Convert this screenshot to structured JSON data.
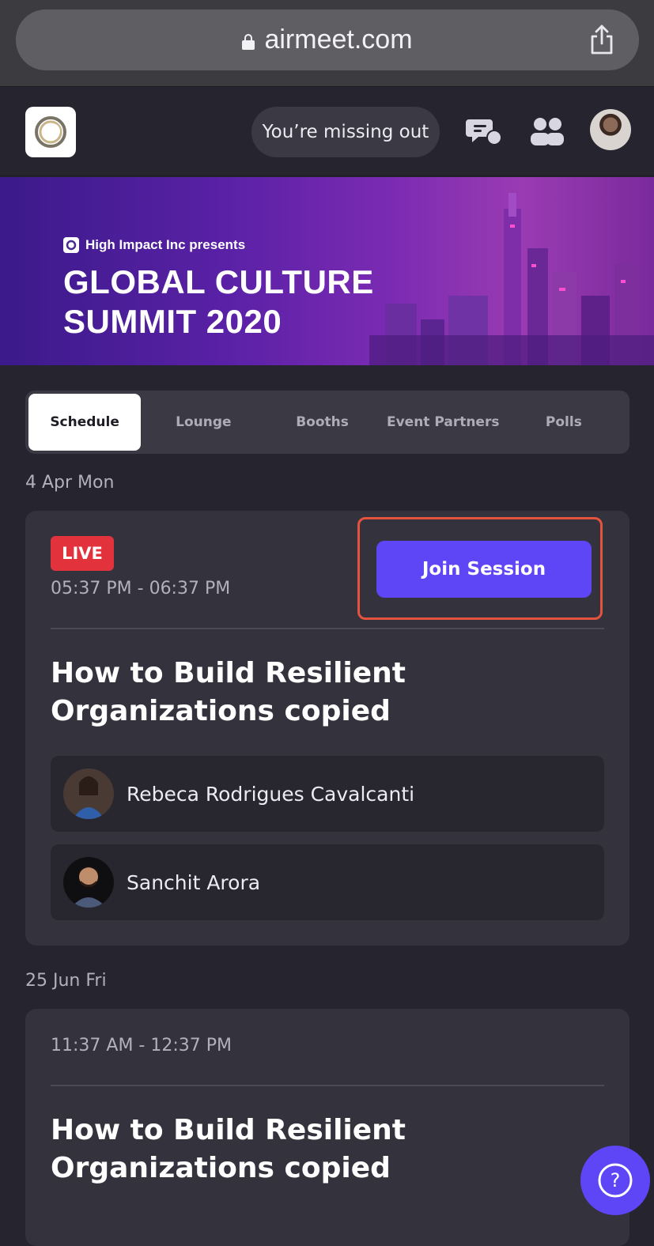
{
  "browser": {
    "url": "airmeet.com"
  },
  "header": {
    "missing_out_label": "You’re missing out"
  },
  "banner": {
    "presenter": "High Impact Inc presents",
    "title_line1": "GLOBAL CULTURE",
    "title_line2": "SUMMIT 2020"
  },
  "tabs": [
    {
      "label": "Schedule",
      "active": true
    },
    {
      "label": "Lounge",
      "active": false
    },
    {
      "label": "Booths",
      "active": false
    },
    {
      "label": "Event Partners",
      "active": false
    },
    {
      "label": "Polls",
      "active": false
    }
  ],
  "schedule": [
    {
      "date": "4 Apr Mon",
      "live_label": "LIVE",
      "time": "05:37 PM - 06:37 PM",
      "join_label": "Join Session",
      "title": "How to Build Resilient Organizations copied",
      "speakers": [
        {
          "name": "Rebeca Rodrigues Cavalcanti"
        },
        {
          "name": "Sanchit Arora"
        }
      ]
    },
    {
      "date": "25 Jun Fri",
      "time": "11:37 AM - 12:37 PM",
      "title": "How to Build Resilient Organizations copied"
    }
  ],
  "help": {
    "icon_text": "?"
  },
  "colors": {
    "accent": "#5e45f5",
    "live": "#e2323c",
    "highlight": "#e5533f",
    "background": "#26252f",
    "card": "#34333d"
  },
  "icons": [
    "lock-icon",
    "share-icon",
    "app-logo",
    "chat-icon",
    "people-icon",
    "help-icon"
  ]
}
